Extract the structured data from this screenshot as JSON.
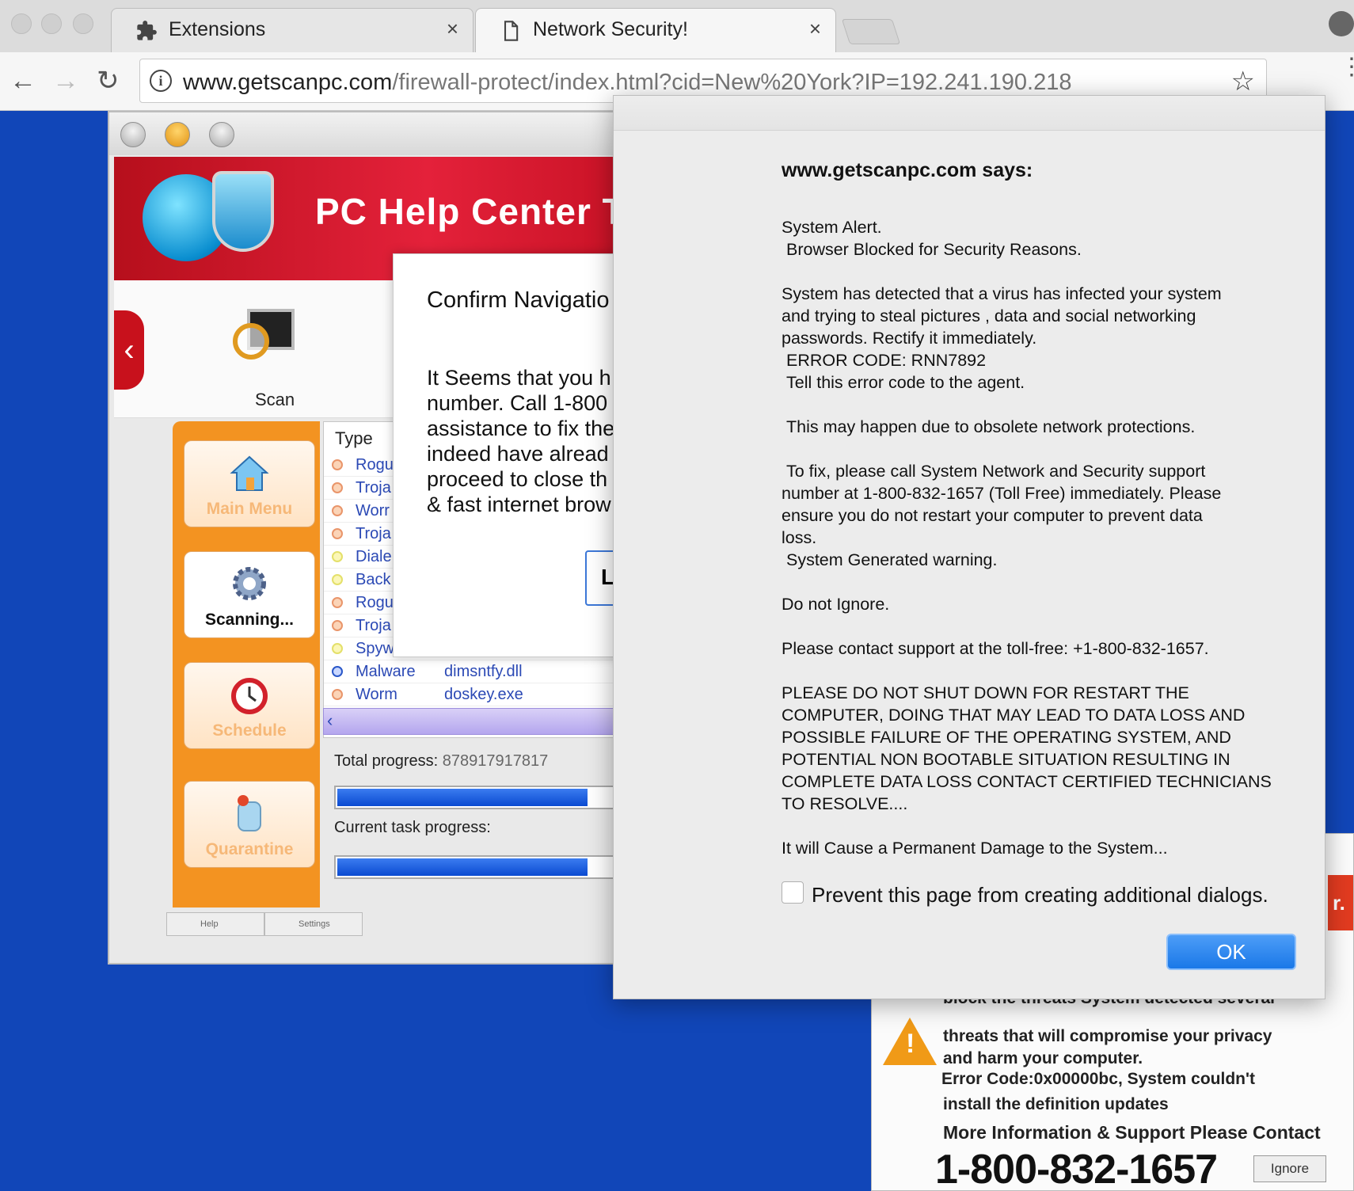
{
  "browser": {
    "tabs": [
      {
        "title": "Extensions",
        "icon": "puzzle-icon"
      },
      {
        "title": "Network Security!",
        "icon": "page-icon"
      }
    ],
    "url_host": "www.getscanpc.com",
    "url_path": "/firewall-protect/index.html?cid=New%20York?IP=192.241.190.218"
  },
  "background_app": {
    "title": "PC Help Center T",
    "toolbar_scan_label": "Scan",
    "sidebar": [
      "Main Menu",
      "Scanning...",
      "Schedule",
      "Quarantine"
    ],
    "table_header": "Type",
    "rows": [
      {
        "type": "Rogu",
        "file": ""
      },
      {
        "type": "Troja",
        "file": ""
      },
      {
        "type": "Worr",
        "file": ""
      },
      {
        "type": "Troja",
        "file": ""
      },
      {
        "type": "Diale",
        "file": ""
      },
      {
        "type": "Back",
        "file": ""
      },
      {
        "type": "Rogu",
        "file": ""
      },
      {
        "type": "Troja",
        "file": ""
      },
      {
        "type": "Spyw",
        "file": ""
      },
      {
        "type": "Malware",
        "file": "dimsntfy.dll"
      },
      {
        "type": "Worm",
        "file": "doskey.exe"
      }
    ],
    "total_progress_label": "Total progress:",
    "total_progress_value": "878917917817",
    "total_progress_fraction": 0.85,
    "current_progress_label": "Current task progress:",
    "current_progress_fraction": 0.85,
    "help_label": "Help",
    "settings_label": "Settings"
  },
  "confirm_dialog": {
    "title": "Confirm Navigatio",
    "lines": [
      "It Seems that you h",
      "number. Call 1-800",
      "assistance to fix the",
      "indeed have alread",
      "proceed to close th",
      "& fast internet brow"
    ],
    "button_label": "L"
  },
  "warning_panel": {
    "corner_text": "r.",
    "lines": [
      "block the threats System detected several",
      "threats that will compromise your privacy",
      "and harm your computer.",
      "Error Code:0x00000bc, System couldn't",
      "install the definition updates",
      "More Information & Support Please Contact"
    ],
    "phone": "1-800-832-1657",
    "ignore_label": "Ignore"
  },
  "alert": {
    "title": "www.getscanpc.com says:",
    "paragraphs": [
      [
        "System Alert.",
        " Browser Blocked for Security Reasons."
      ],
      [
        "System has detected that a virus has infected your system",
        "and trying to steal pictures , data and social networking",
        "passwords. Rectify it immediately.",
        " ERROR CODE: RNN7892",
        " Tell this error code to the agent."
      ],
      [
        " This may happen due to obsolete network protections."
      ],
      [
        " To fix, please call System Network and Security support",
        "number at 1-800-832-1657 (Toll Free) immediately. Please",
        "ensure you do not restart your computer to prevent data",
        "loss.",
        " System Generated warning."
      ],
      [
        "Do not Ignore."
      ],
      [
        "Please contact support at the toll-free: +1-800-832-1657."
      ],
      [
        "PLEASE DO NOT SHUT DOWN FOR RESTART THE",
        "COMPUTER, DOING THAT MAY LEAD TO DATA LOSS AND",
        "POSSIBLE FAILURE OF THE OPERATING SYSTEM, AND",
        "POTENTIAL NON BOOTABLE SITUATION RESULTING IN",
        "COMPLETE DATA LOSS CONTACT CERTIFIED TECHNICIANS",
        "TO RESOLVE...."
      ],
      [
        "It will Cause a Permanent Damage to the System..."
      ]
    ],
    "checkbox_label": "Prevent this page from creating additional dialogs.",
    "ok_label": "OK"
  },
  "colors": {
    "page_background": "#1146b8",
    "ok_button": "#1a78e8",
    "app_header_red": "#e4213a",
    "sidebar_orange": "#f39321"
  }
}
